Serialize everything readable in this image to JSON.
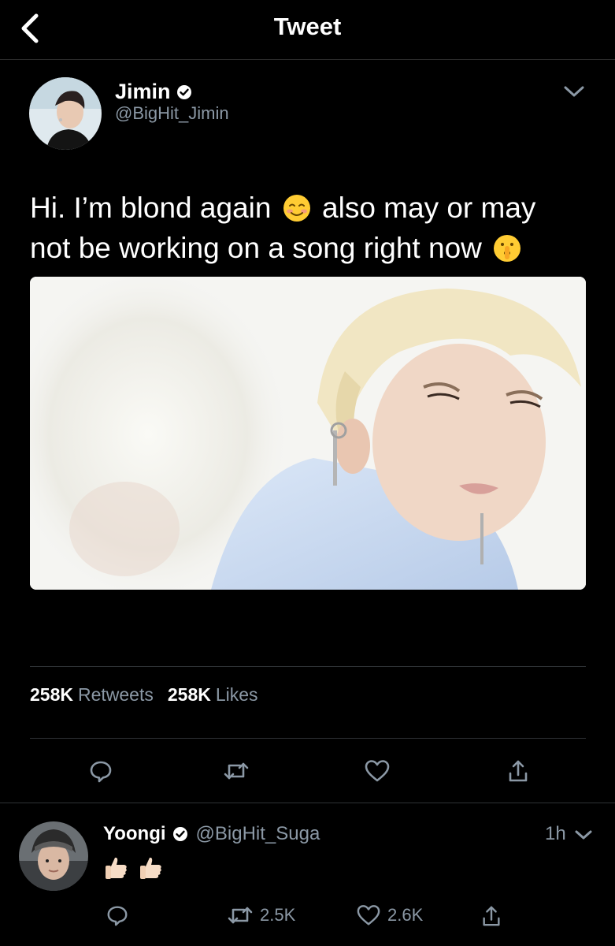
{
  "header": {
    "title": "Tweet"
  },
  "tweet": {
    "author_name": "Jimin",
    "author_handle": "@BigHit_Jimin",
    "text_part1": "Hi. I’m blond again",
    "text_part2": "also may or may not be working on a song right now",
    "stats": {
      "retweets": "258K",
      "retweets_label": "Retweets",
      "likes": "258K",
      "likes_label": "Likes"
    }
  },
  "reply": {
    "author_name": "Yoongi",
    "author_handle": "@BigHit_Suga",
    "time": "1h",
    "retweets": "2.5K",
    "likes": "2.6K"
  },
  "icons": {
    "back": "back-arrow-icon",
    "verified": "verified-badge-icon",
    "caret": "chevron-down-icon",
    "reply": "reply-icon",
    "retweet": "retweet-icon",
    "like": "heart-icon",
    "share": "share-icon"
  },
  "colors": {
    "background": "#000000",
    "text": "#ffffff",
    "secondary_text": "#8b98a5",
    "divider": "#2f3336"
  }
}
